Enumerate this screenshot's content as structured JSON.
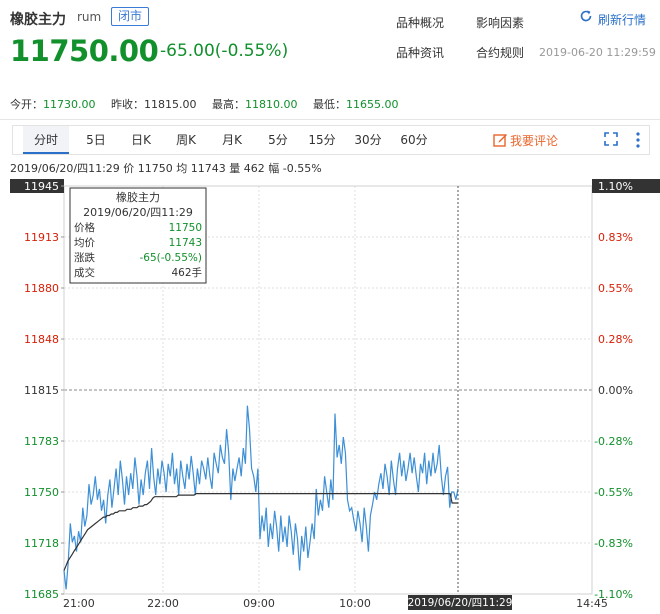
{
  "header": {
    "name": "橡胶主力",
    "code": "rum",
    "status_badge": "闭市",
    "price": "11750.00",
    "change": "-65.00(-0.55%)",
    "links": [
      "品种概况",
      "影响因素",
      "品种资讯",
      "合约规则"
    ],
    "refresh_label": "刷新行情",
    "timestamp": "2019-06-20 11:29:59"
  },
  "stats": {
    "open_label": "今开：",
    "open": "11730.00",
    "prev_label": "昨收：",
    "prev": "11815.00",
    "high_label": "最高：",
    "high": "11810.00",
    "low_label": "最低：",
    "low": "11655.00"
  },
  "tabs": [
    "分时",
    "5日",
    "日K",
    "周K",
    "月K",
    "5分",
    "15分",
    "30分",
    "60分"
  ],
  "comment_label": "我要评论",
  "info_line": "2019/06/20/四11:29  价 11750  均 11743  量 462  幅 -0.55%",
  "tooltip": {
    "title": "橡胶主力",
    "date": "2019/06/20/四11:29",
    "rows": [
      {
        "label": "价格",
        "value": "11750"
      },
      {
        "label": "均价",
        "value": "11743"
      },
      {
        "label": "涨跌",
        "value": "-65(-0.55%)"
      },
      {
        "label": "成交",
        "value": "462手"
      }
    ]
  },
  "colors": {
    "up": "#d81e06",
    "down": "#12902c",
    "price_line": "#3d8fd6",
    "avg_line": "#333333",
    "accent": "#2a70c8"
  },
  "chart_data": {
    "type": "line",
    "ylim": [
      11685,
      11945
    ],
    "y_ticks": [
      "11945",
      "11913",
      "11880",
      "11848",
      "11815",
      "11783",
      "11750",
      "11718",
      "11685"
    ],
    "pct_ticks": [
      "1.10%",
      "0.83%",
      "0.55%",
      "0.28%",
      "0.00%",
      "-0.28%",
      "-0.55%",
      "-0.83%",
      "-1.10%"
    ],
    "x_ticks": [
      "21:00",
      "22:00",
      "09:00",
      "10:00",
      "14:45"
    ],
    "cursor_label": "2019/06/20/四11:29",
    "series": [
      {
        "values": [
          11700,
          11688,
          11705,
          11730,
          11718,
          11722,
          11712,
          11725,
          11718,
          11740,
          11728,
          11735,
          11755,
          11742,
          11748,
          11760,
          11745,
          11752,
          11738,
          11745,
          11730,
          11748,
          11758,
          11740,
          11752,
          11765,
          11748,
          11770,
          11758,
          11742,
          11760,
          11748,
          11762,
          11752,
          11772,
          11760,
          11742,
          11758,
          11748,
          11762,
          11770,
          11752,
          11778,
          11760,
          11748,
          11765,
          11755,
          11770,
          11762,
          11750,
          11768,
          11760,
          11775,
          11755,
          11765,
          11748,
          11770,
          11760,
          11752,
          11768,
          11758,
          11773,
          11762,
          11748,
          11765,
          11755,
          11770,
          11765,
          11758,
          11772,
          11760,
          11752,
          11775,
          11768,
          11762,
          11780,
          11772,
          11768,
          11790,
          11775,
          11745,
          11765,
          11757,
          11765,
          11772,
          11760,
          11778,
          11768,
          11805,
          11790,
          11765,
          11760,
          11750,
          11765,
          11720,
          11735,
          11725,
          11740,
          11715,
          11730,
          11720,
          11738,
          11728,
          11712,
          11735,
          11718,
          11728,
          11715,
          11735,
          11725,
          11710,
          11730,
          11720,
          11700,
          11722,
          11712,
          11728,
          11708,
          11718,
          11730,
          11720,
          11752,
          11735,
          11745,
          11738,
          11760,
          11750,
          11740,
          11758,
          11745,
          11800,
          11772,
          11780,
          11768,
          11785,
          11775,
          11745,
          11738,
          11740,
          11732,
          11725,
          11738,
          11730,
          11718,
          11740,
          11728,
          11712,
          11735,
          11742,
          11750,
          11745,
          11755,
          11762,
          11752,
          11768,
          11760,
          11748,
          11770,
          11758,
          11748,
          11765,
          11775,
          11760,
          11770,
          11757,
          11765,
          11775,
          11762,
          11772,
          11760,
          11750,
          11768,
          11762,
          11775,
          11755,
          11770,
          11760,
          11775,
          11762,
          11768,
          11780,
          11760,
          11748,
          11760,
          11766,
          11740,
          11750,
          11750,
          11745,
          11752
        ]
      },
      {
        "values": [
          11700,
          11703,
          11706,
          11708,
          11710,
          11712,
          11714,
          11716,
          11718,
          11720,
          11722,
          11724,
          11726,
          11727,
          11728,
          11729,
          11730,
          11731,
          11732,
          11733,
          11734,
          11734,
          11735,
          11735,
          11736,
          11736,
          11737,
          11737,
          11738,
          11738,
          11738,
          11738,
          11739,
          11739,
          11739,
          11740,
          11740,
          11740,
          11741,
          11741,
          11741,
          11742,
          11742,
          11743,
          11744,
          11746,
          11747,
          11747,
          11747,
          11747,
          11747,
          11747,
          11747,
          11747,
          11747,
          11747,
          11747,
          11747,
          11748,
          11748,
          11748,
          11748,
          11748,
          11748,
          11748,
          11748,
          11748,
          11749,
          11749,
          11749,
          11749,
          11749,
          11749,
          11749,
          11749,
          11749,
          11749,
          11749,
          11749,
          11749,
          11749,
          11749,
          11749,
          11749,
          11749,
          11749,
          11749,
          11749,
          11749,
          11749,
          11749,
          11749,
          11749,
          11749,
          11749,
          11749,
          11749,
          11749,
          11749,
          11749,
          11749,
          11749,
          11749,
          11749,
          11749,
          11749,
          11749,
          11749,
          11749,
          11749,
          11749,
          11749,
          11749,
          11749,
          11749,
          11749,
          11749,
          11749,
          11749,
          11749,
          11749,
          11749,
          11749,
          11749,
          11749,
          11749,
          11749,
          11749,
          11749,
          11749,
          11749,
          11749,
          11749,
          11749,
          11749,
          11749,
          11749,
          11749,
          11749,
          11749,
          11749,
          11749,
          11749,
          11749,
          11749,
          11749,
          11749,
          11749,
          11749,
          11749,
          11749,
          11749,
          11749,
          11749,
          11749,
          11749,
          11749,
          11749,
          11749,
          11749,
          11749,
          11749,
          11749,
          11749,
          11749,
          11749,
          11749,
          11749,
          11749,
          11749,
          11749,
          11749,
          11749,
          11749,
          11749,
          11749,
          11749,
          11749,
          11749,
          11749,
          11749,
          11749,
          11749,
          11749,
          11749,
          11749,
          11749,
          11749,
          11749,
          11749,
          11749,
          11749,
          11749,
          11749,
          11749,
          11749,
          11749,
          11743,
          11743,
          11743,
          11743
        ]
      }
    ]
  }
}
